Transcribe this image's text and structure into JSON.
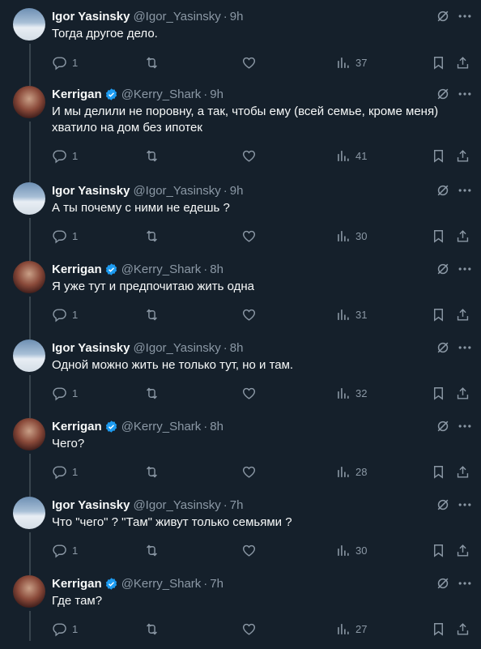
{
  "colors": {
    "background": "#15202b",
    "text": "#f7f9f9",
    "muted": "#8b98a5",
    "verified": "#1d9bf0"
  },
  "icons": {
    "reply": "reply-icon",
    "retweet": "retweet-icon",
    "like": "heart-icon",
    "views": "views-icon",
    "bookmark": "bookmark-icon",
    "share": "share-icon",
    "grok": "grok-icon",
    "more": "more-icon",
    "verified": "verified-badge-icon"
  },
  "tweets": [
    {
      "name": "Igor Yasinsky",
      "handle": "@Igor_Yasinsky",
      "time": "9h",
      "text": "Тогда другое дело.",
      "replies": "1",
      "views": "37"
    },
    {
      "name": "Kerrigan",
      "handle": "@Kerry_Shark",
      "time": "9h",
      "text": "И мы делили не поровну, а так, чтобы ему (всей семье, кроме меня) хватило на дом без ипотек",
      "replies": "1",
      "views": "41"
    },
    {
      "name": "Igor Yasinsky",
      "handle": "@Igor_Yasinsky",
      "time": "9h",
      "text": "А ты почему с ними не едешь ?",
      "replies": "1",
      "views": "30"
    },
    {
      "name": "Kerrigan",
      "handle": "@Kerry_Shark",
      "time": "8h",
      "text": "Я уже тут и предпочитаю жить одна",
      "replies": "1",
      "views": "31"
    },
    {
      "name": "Igor Yasinsky",
      "handle": "@Igor_Yasinsky",
      "time": "8h",
      "text": "Одной можно жить не только тут, но и там.",
      "replies": "1",
      "views": "32"
    },
    {
      "name": "Kerrigan",
      "handle": "@Kerry_Shark",
      "time": "8h",
      "text": "Чего?",
      "replies": "1",
      "views": "28"
    },
    {
      "name": "Igor Yasinsky",
      "handle": "@Igor_Yasinsky",
      "time": "7h",
      "text": "Что \"чего\" ? \"Там\" живут только семьями ?",
      "replies": "1",
      "views": "30"
    },
    {
      "name": "Kerrigan",
      "handle": "@Kerry_Shark",
      "time": "7h",
      "text": "Где там?",
      "replies": "1",
      "views": "27"
    }
  ]
}
